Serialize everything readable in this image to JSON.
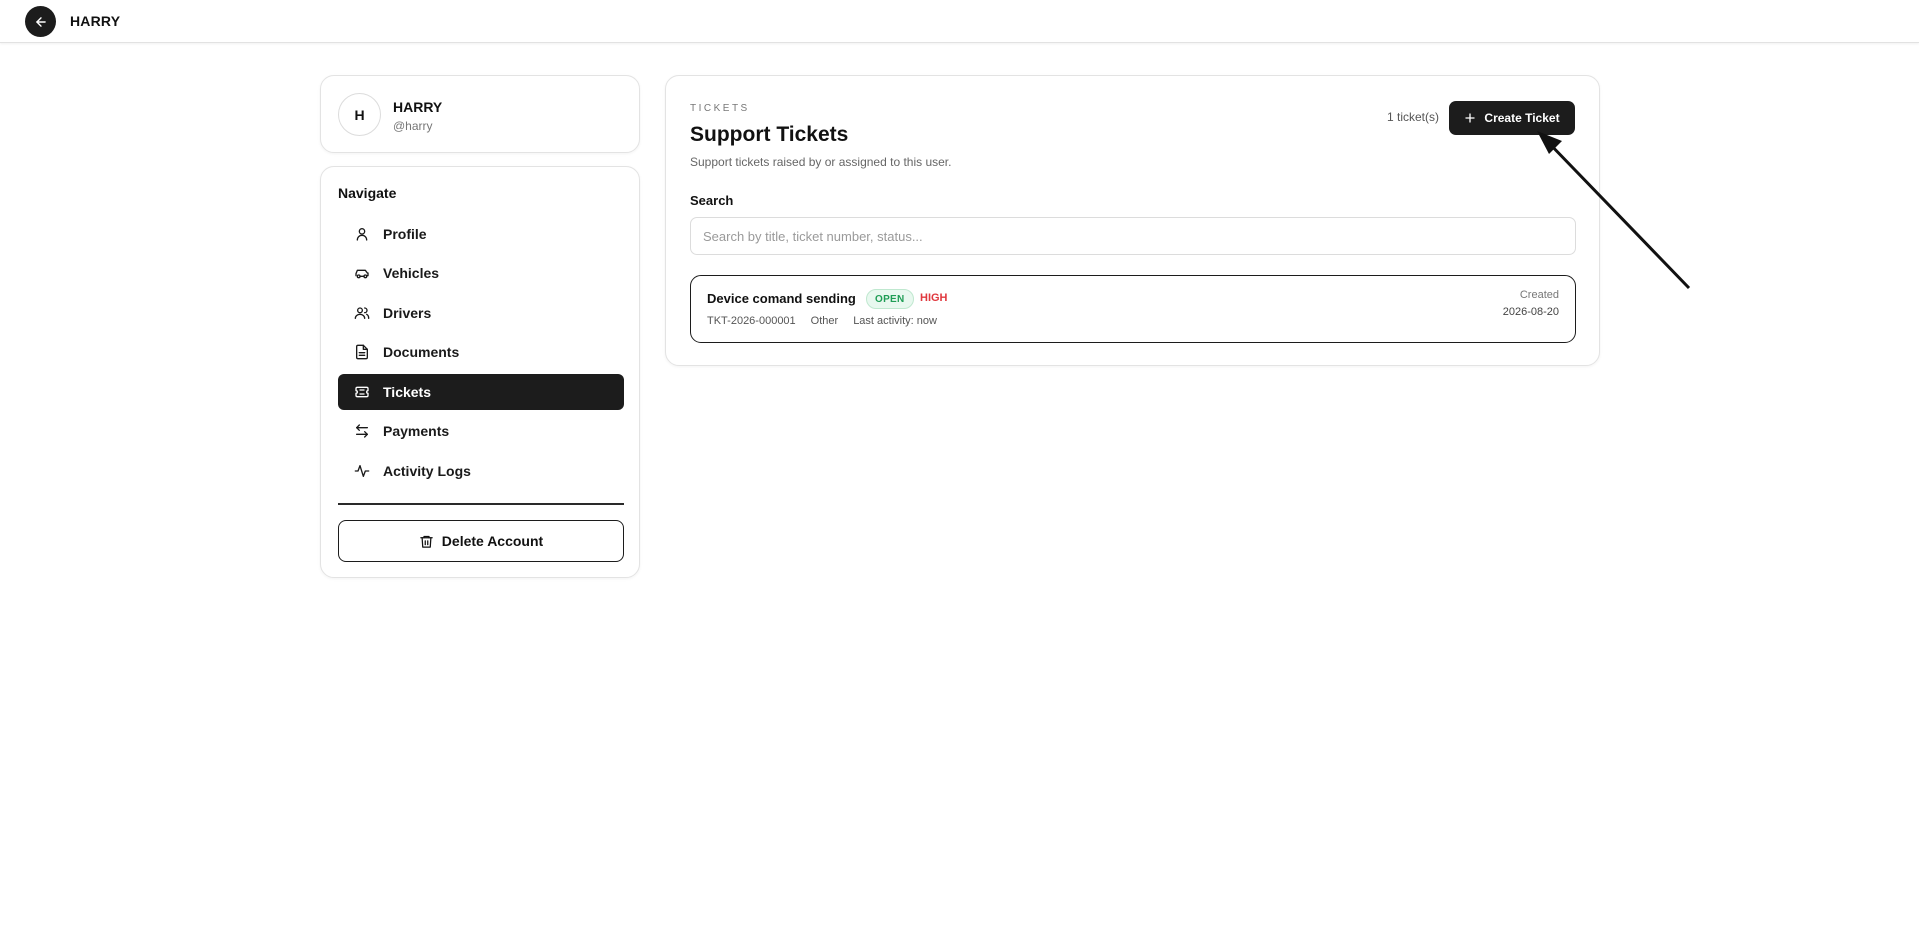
{
  "header": {
    "title": "HARRY",
    "back_icon": "arrow-left-icon"
  },
  "user": {
    "avatar_initial": "H",
    "name": "HARRY",
    "handle": "@harry"
  },
  "navigation": {
    "heading": "Navigate",
    "items": [
      {
        "label": "Profile",
        "icon": "user-icon",
        "active": false
      },
      {
        "label": "Vehicles",
        "icon": "car-icon",
        "active": false
      },
      {
        "label": "Drivers",
        "icon": "users-icon",
        "active": false
      },
      {
        "label": "Documents",
        "icon": "file-text-icon",
        "active": false
      },
      {
        "label": "Tickets",
        "icon": "ticket-icon",
        "active": true
      },
      {
        "label": "Payments",
        "icon": "arrows-swap-icon",
        "active": false
      },
      {
        "label": "Activity Logs",
        "icon": "activity-icon",
        "active": false
      }
    ],
    "delete_label": "Delete Account"
  },
  "tickets": {
    "eyebrow": "TICKETS",
    "title": "Support Tickets",
    "description": "Support tickets raised by or assigned to this user.",
    "count": "1 ticket(s)",
    "create_label": "Create Ticket",
    "search_label": "Search",
    "search_placeholder": "Search by title, ticket number, status...",
    "rows": [
      {
        "title": "Device comand sending",
        "status": "OPEN",
        "priority": "HIGH",
        "number": "TKT-2026-000001",
        "category": "Other",
        "last_activity": "Last activity: now",
        "created_label": "Created",
        "created_date": "2026-08-20"
      }
    ]
  },
  "colors": {
    "primary": "#1c1c1c",
    "status_open": "#1f9d55",
    "priority_high": "#e0383e"
  }
}
